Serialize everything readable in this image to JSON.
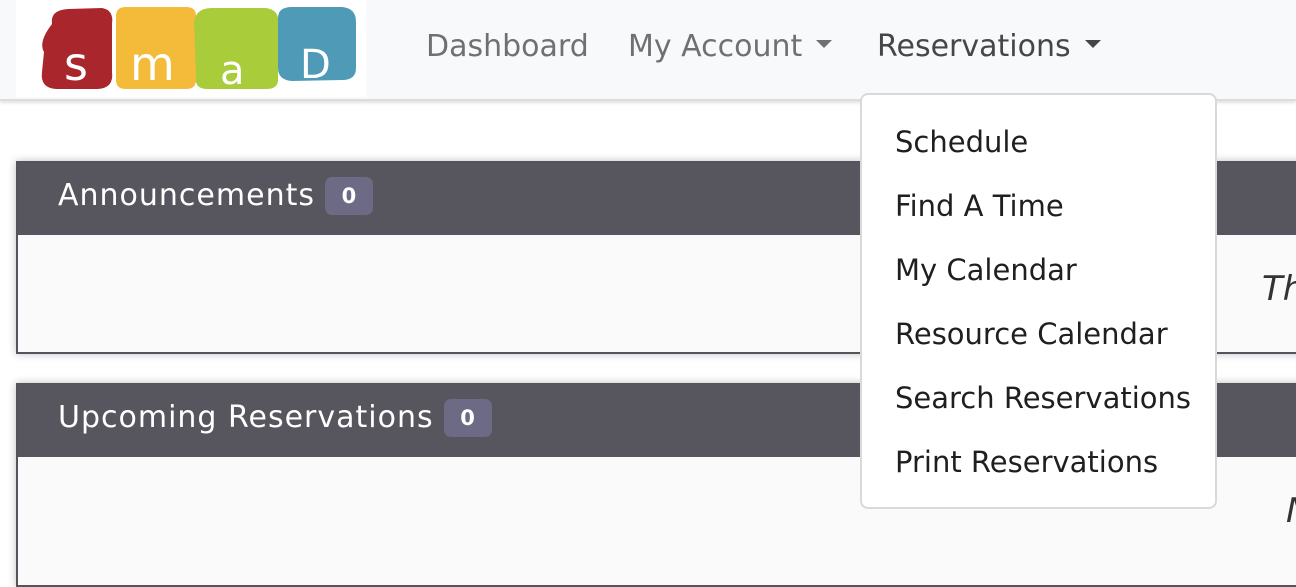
{
  "brand": {
    "logo_text": "smaD"
  },
  "nav": {
    "dashboard": "Dashboard",
    "my_account": "My Account",
    "reservations": "Reservations"
  },
  "reservations_menu": [
    {
      "label": "Schedule"
    },
    {
      "label": "Find A Time"
    },
    {
      "label": "My Calendar"
    },
    {
      "label": "Resource Calendar"
    },
    {
      "label": "Search Reservations"
    },
    {
      "label": "Print Reservations"
    }
  ],
  "announcements": {
    "title": "Announcements",
    "count": "0",
    "body_text": "Th"
  },
  "upcoming": {
    "title": "Upcoming Reservations",
    "count": "0",
    "body_text": "N"
  },
  "colors": {
    "logo_red": "#a8262c",
    "logo_yellow": "#f4bb3a",
    "logo_green": "#a9cc3b",
    "logo_blue": "#4f9ab7",
    "panel_header": "#57555d",
    "badge": "#6d6a85"
  }
}
